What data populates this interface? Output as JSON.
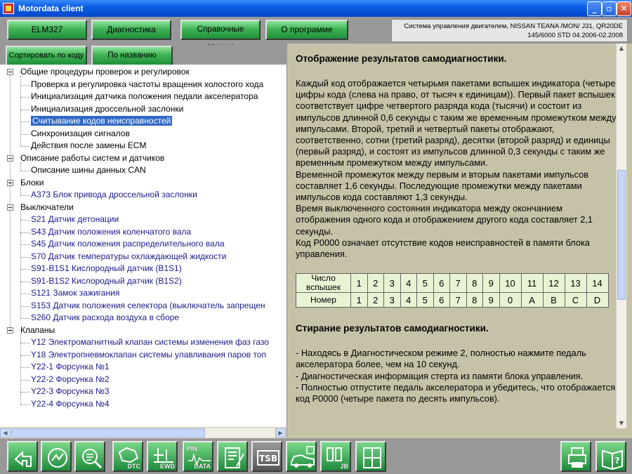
{
  "window": {
    "title": "Motordata client"
  },
  "menu": {
    "elm": "ELM327",
    "diag": "Диагностика",
    "ref": "Справочные данные",
    "about": "О программе"
  },
  "sysinfo": {
    "line1": "Система управления двигателем, NISSAN  TEANA /MON/  J31,    QR20DE",
    "line2": "145/6000  STD  04.2006-02.2008"
  },
  "sort": {
    "by_code": "Сортировать по коду",
    "by_name": "По названию"
  },
  "tree": {
    "cat1": "Общие процедуры проверок и регулировок",
    "c1_items": [
      "Проверка и регулировка частоты вращения холостого хода",
      "Инициализация датчика положения педали акселератора",
      "Инициализация дроссельной заслонки",
      "Считывание кодов неисправностей",
      "Синхронизация сигналов",
      "Действия после замены ECM"
    ],
    "cat2": "Описание работы систем и датчиков",
    "c2_items": [
      "Описание шины данных CAN"
    ],
    "cat3": "Блоки",
    "c3_items": [
      "A373  Блок привода дроссельной заслонки"
    ],
    "cat4": "Выключатели",
    "c4_items": [
      "S21  Датчик детонации",
      "S43  Датчик положения коленчатого вала",
      "S45  Датчик положения распределительного вала",
      "S70  Датчик температуры охлаждающей жидкости",
      "S91-B1S1  Кислородный датчик (B1S1)",
      "S91-B1S2  Кислородный датчик (B1S2)",
      "S121  Замок зажигания",
      "S153  Датчик положения селектора (выключатель запрещен",
      "S260  Датчик расхода воздуха в сборе"
    ],
    "cat5": "Клапаны",
    "c5_items": [
      "Y12  Электромагнитный клапан системы изменения фаз газо",
      "Y18  Электропневмоклапан системы улавливания паров топ",
      "Y22-1  Форсунка №1",
      "Y22-2  Форсунка №2",
      "Y22-3  Форсунка №3",
      "Y22-4  Форсунка №4"
    ]
  },
  "doc": {
    "h1": "Отображение результатов самодиагностики.",
    "p1": "Каждый код отображается четырьмя пакетами вспышек индикатора (четыре цифры кода (слева на право, от тысяч к единицам)). Первый пакет вспышек соответствует цифре четвертого разряда кода (тысячи) и состоит из импульсов длинной 0,6 секунды с таким же временным промежутком между импульсами. Второй, третий и четвертый пакеты отображают, соответственно, сотни (третий разряд), десятки (второй разряд) и единицы (первый разряд), и состоят из импульсов длинной 0,3 секунды с таким же временным промежутком между импульсами.",
    "p2": "Временной промежуток между первым и вторым пакетами импульсов составляет 1,6 секунды. Последующие промежутки между пакетами импульсов кода составляют 1,3 секунды.",
    "p3": "Время выключенного состояния индикатора между окончанием отображения одного кода и отображением другого кода составляет 2,1 секунды.",
    "p4": "Код P0000 означает отсутствие кодов неисправностей в памяти блока управления.",
    "table": {
      "row1_label": "Число вспышек",
      "row2_label": "Номер",
      "row1": [
        "1",
        "2",
        "3",
        "4",
        "5",
        "6",
        "7",
        "8",
        "9",
        "10",
        "11",
        "12",
        "13",
        "14"
      ],
      "row2": [
        "1",
        "2",
        "3",
        "4",
        "5",
        "6",
        "7",
        "8",
        "9",
        "0",
        "A",
        "B",
        "C",
        "D"
      ]
    },
    "h2": "Стирание результатов самодиагностики.",
    "p5": "- Находясь в Диагностическом режиме 2, полностью нажмите педаль акселератора более, чем на 10 секунд.",
    "p6": "- Диагностическая информация стерта из памяти блока управления.",
    "p7": "- Полностью отпустите педаль акселератора и убедитесь, что отображается код P0000 (четыре пакета по десять импульсов)."
  },
  "toolbar": {
    "dtc": "DTC",
    "ewd": "EWD",
    "pin1": "PIN",
    "pin2": "DATA",
    "tsb": "TSB",
    "jb": "JB"
  }
}
